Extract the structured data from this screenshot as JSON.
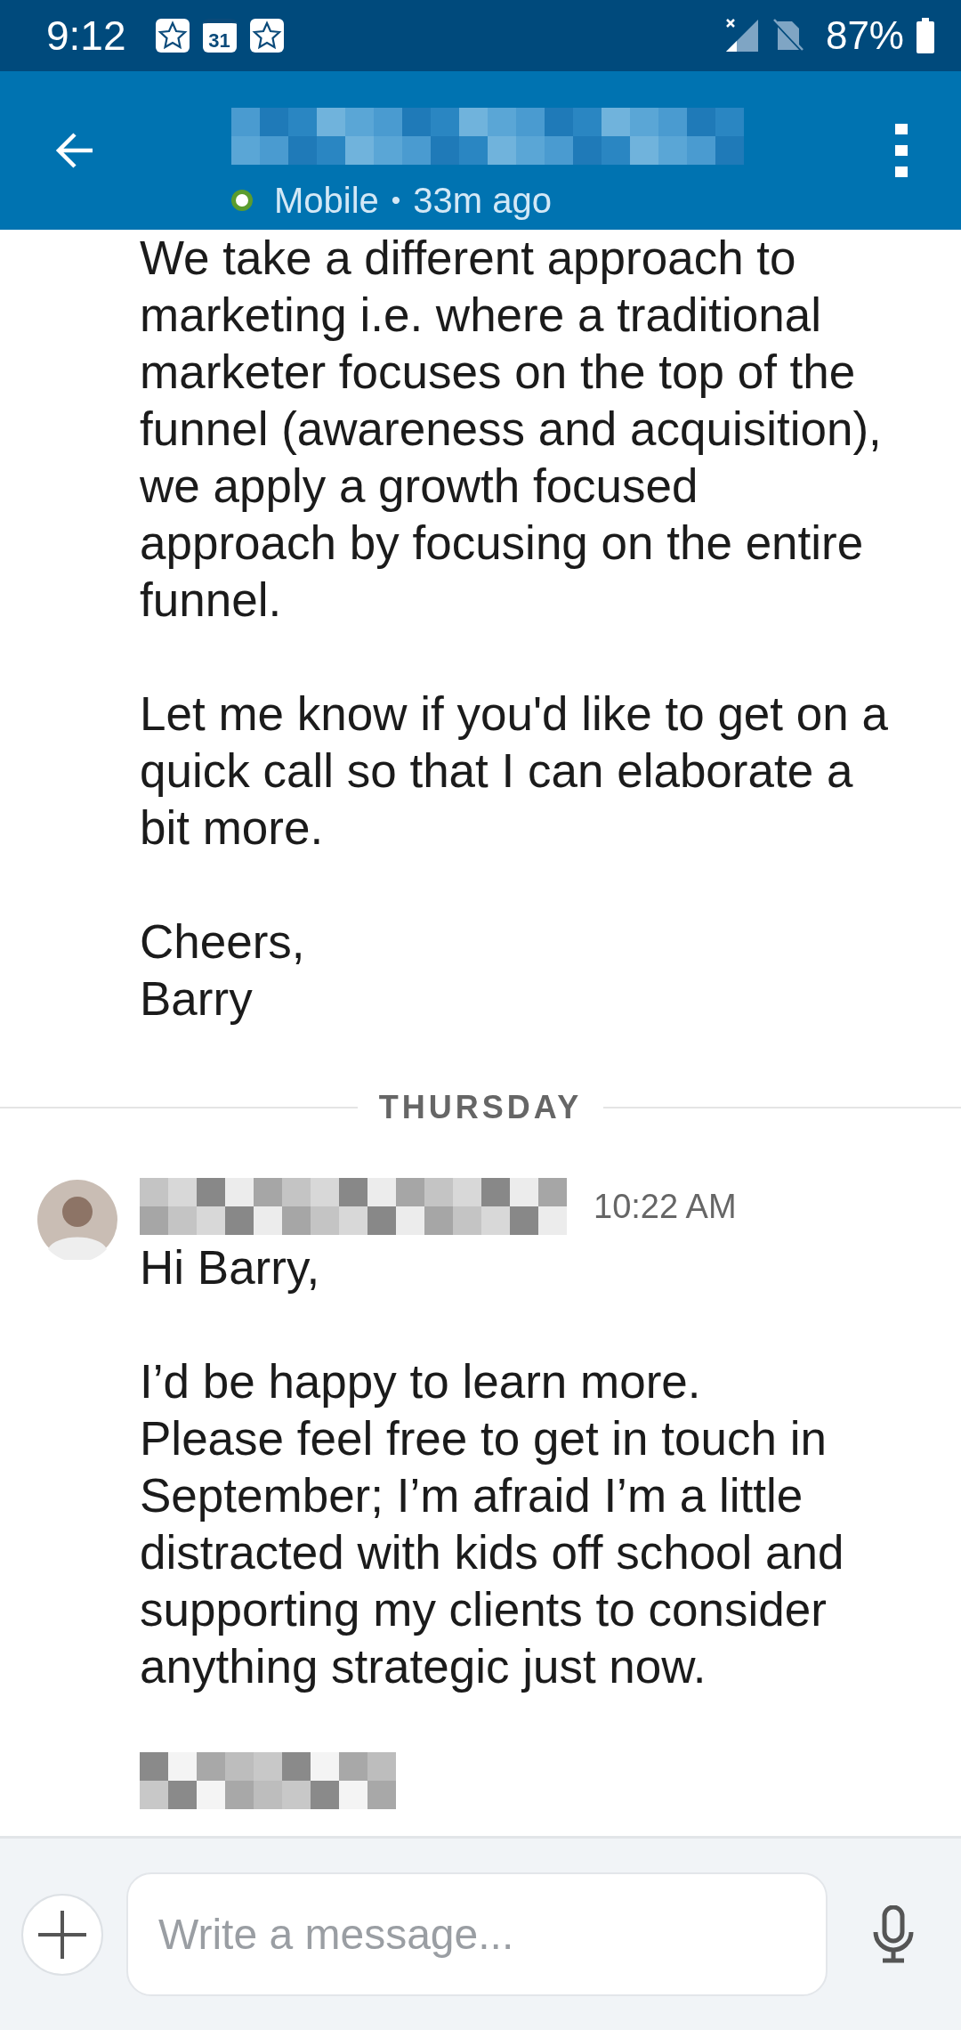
{
  "status_bar": {
    "time": "9:12",
    "calendar_day": "31",
    "battery": "87%"
  },
  "header": {
    "online": true,
    "presence": "Mobile",
    "separator": "•",
    "last_seen": "33m ago"
  },
  "thread": [
    {
      "kind": "text",
      "paragraphs": [
        "We take a different approach to\nmarketing i.e. where a traditional\nmarketer focuses on the top of the\nfunnel (awareness and acquisition),\nwe apply a growth focused\napproach by focusing on the entire\nfunnel.",
        "Let me know if you'd like to get on a\nquick call so that I can elaborate a\nbit more.",
        "Cheers,\nBarry"
      ]
    },
    {
      "kind": "divider",
      "label": "THURSDAY"
    },
    {
      "kind": "message",
      "time": "10:22 AM",
      "paragraphs": [
        "Hi Barry,",
        "I’d be happy to learn more.\nPlease feel free to get in touch in\nSeptember; I’m afraid I’m a little\ndistracted with kids off school and\nsupporting my clients to consider\nanything strategic just now."
      ],
      "signature_hidden": true
    }
  ],
  "composer": {
    "placeholder": "Write a message..."
  }
}
